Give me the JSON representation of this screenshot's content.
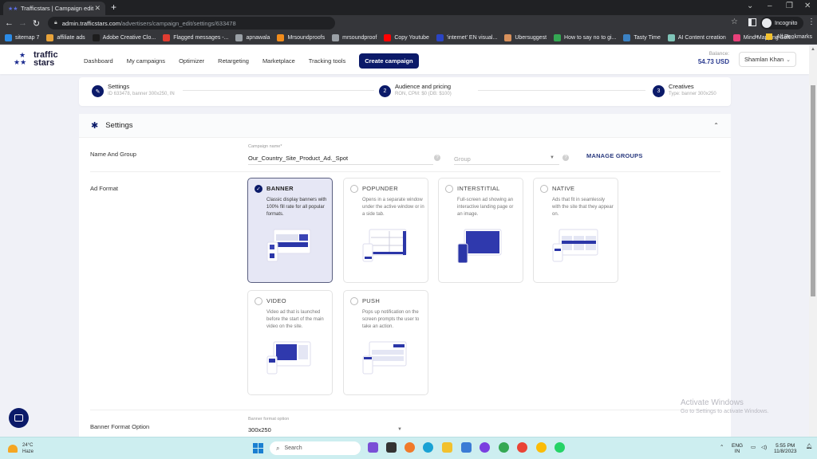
{
  "browser": {
    "tab_title": "Trafficstars | Campaign edit",
    "url_host": "admin.trafficstars.com",
    "url_path": "/advertisers/campaign_edit/settings/633478",
    "profile_label": "Incognito",
    "bookmarks": [
      {
        "label": "sitemap 7",
        "color": "#2b8be6"
      },
      {
        "label": "affiliate ads",
        "color": "#e8a33a"
      },
      {
        "label": "Adobe Creative Clo...",
        "color": "#1d1d1d"
      },
      {
        "label": "Flagged messages -...",
        "color": "#e03c31"
      },
      {
        "label": "apnawala",
        "color": "#9aa0a6"
      },
      {
        "label": "Mrsoundproofs",
        "color": "#f28c1b"
      },
      {
        "label": "mrsoundproof",
        "color": "#9aa0a6"
      },
      {
        "label": "Copy Youtube",
        "color": "#ff0000"
      },
      {
        "label": "'internet' EN visual...",
        "color": "#2a44c4"
      },
      {
        "label": "Ubersuggest",
        "color": "#d8915c"
      },
      {
        "label": "How to say no to gi...",
        "color": "#34a853"
      },
      {
        "label": "Tasty Time",
        "color": "#3b82c4"
      },
      {
        "label": "AI Content creation",
        "color": "#7fc4b8"
      },
      {
        "label": "Mind Mapping Soft...",
        "color": "#e8407a"
      }
    ],
    "more_bookmarks": "»",
    "all_bookmarks": "All Bookmarks"
  },
  "app": {
    "logo_line1": "traffic",
    "logo_line2": "stars",
    "nav": [
      "Dashboard",
      "My campaigns",
      "Optimizer",
      "Retargeting",
      "Marketplace",
      "Tracking tools"
    ],
    "create_campaign": "Create campaign",
    "balance_label": "Balance:",
    "balance_value": "54.73 USD",
    "user_name": "Shamlan Khan",
    "accent_color": "#0b1a69"
  },
  "stepper": [
    {
      "number": "",
      "title": "Settings",
      "subtitle": "ID 633478, banner 300x250, IN"
    },
    {
      "number": "2",
      "title": "Audience and pricing",
      "subtitle": "RON, CPM: $0 (DB: $100)"
    },
    {
      "number": "3",
      "title": "Creatives",
      "subtitle": "Type: banner 300x250"
    }
  ],
  "settings": {
    "section_title": "Settings",
    "name_group_label": "Name And Group",
    "campaign_name_label": "Campaign name*",
    "campaign_name_value": "Our_Country_Site_Product_Ad._Spot",
    "group_placeholder": "Group",
    "manage_groups": "MANAGE GROUPS",
    "ad_format_label": "Ad Format",
    "formats": [
      {
        "name": "BANNER",
        "desc": "Classic display banners with 100% fill rate for all popular formats.",
        "selected": true
      },
      {
        "name": "POPUNDER",
        "desc": "Opens in a separate window under the active window or in a side tab.",
        "selected": false
      },
      {
        "name": "INTERSTITIAL",
        "desc": "Full-screen ad showing an interactive landing page or an image.",
        "selected": false
      },
      {
        "name": "NATIVE",
        "desc": "Ads that fit in seamlessly with the site that they appear on.",
        "selected": false
      },
      {
        "name": "VIDEO",
        "desc": "Video ad that is launched before the start of the main video on the site.",
        "selected": false
      },
      {
        "name": "PUSH",
        "desc": "Pops up notification on the screen prompts the user to take an action.",
        "selected": false
      }
    ],
    "banner_format_row_label": "Banner Format Option",
    "banner_format_field_label": "Banner format option",
    "banner_format_value": "300x250"
  },
  "watermark": {
    "line1": "Activate Windows",
    "line2": "Go to Settings to activate Windows."
  },
  "taskbar": {
    "temperature": "24°C",
    "weather": "Haze",
    "search_placeholder": "Search",
    "lang1": "ENG",
    "lang2": "IN",
    "time": "5:55 PM",
    "date": "11/8/2023"
  }
}
